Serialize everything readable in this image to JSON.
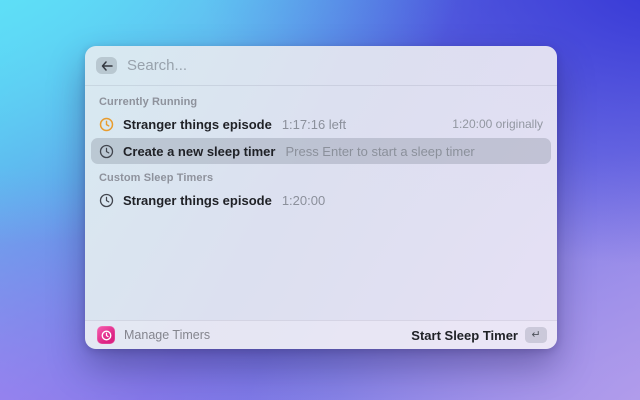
{
  "search": {
    "placeholder": "Search...",
    "back_icon": "left-arrow"
  },
  "sections": [
    {
      "title": "Currently Running",
      "items": [
        {
          "icon": "clock-icon-orange",
          "title": "Stranger things episode",
          "subtitle": "1:17:16 left",
          "accessory": "1:20:00 originally",
          "selected": false
        },
        {
          "icon": "clock-icon-dark",
          "title": "Create a new sleep timer",
          "subtitle": "Press Enter to start a sleep timer",
          "accessory": "",
          "selected": true
        }
      ]
    },
    {
      "title": "Custom Sleep Timers",
      "items": [
        {
          "icon": "clock-icon-dark",
          "title": "Stranger things episode",
          "subtitle": "1:20:00",
          "accessory": "",
          "selected": false
        }
      ]
    }
  ],
  "footer": {
    "app_icon": "sleep-timer-app-icon",
    "manage_label": "Manage Timers",
    "primary_action": "Start Sleep Timer",
    "enter_key": "↵"
  },
  "colors": {
    "clock_orange": "#e89c2e",
    "clock_dark": "#42464e",
    "app_icon_pink": "#dc2384",
    "selection_gray": "#c6cbd4"
  }
}
